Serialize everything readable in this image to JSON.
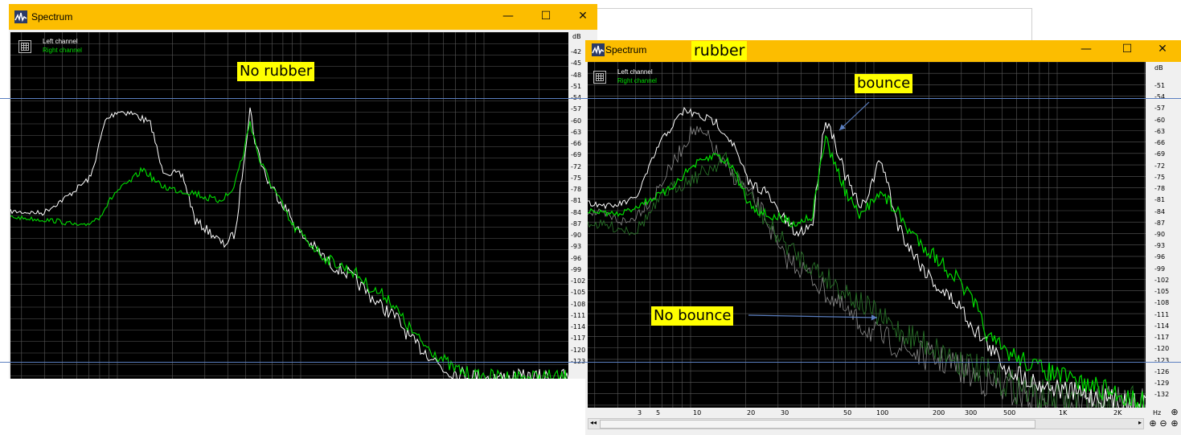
{
  "window_title": "Spectrum",
  "left_window": {
    "title": "Spectrum",
    "legend": {
      "left": "Left channel",
      "right": "Right channel"
    },
    "callout": "No rubber",
    "db_unit": "dB",
    "db_ticks": [
      "-42",
      "-45",
      "-48",
      "-51",
      "-54",
      "-57",
      "-60",
      "-63",
      "-66",
      "-69",
      "-72",
      "-75",
      "-78",
      "-81",
      "-84",
      "-87",
      "-90",
      "-93",
      "-96",
      "-99",
      "-102",
      "-105",
      "-108",
      "-111",
      "-114",
      "-117",
      "-120",
      "-123"
    ]
  },
  "right_window": {
    "title": "Spectrum",
    "legend": {
      "left": "Left channel",
      "right": "Right channel"
    },
    "callout_title": "rubber",
    "callout_bounce": "bounce",
    "callout_nobounce": "No bounce",
    "db_unit": "dB",
    "hz_unit": "Hz",
    "db_ticks": [
      "-51",
      "-54",
      "-57",
      "-60",
      "-63",
      "-66",
      "-69",
      "-72",
      "-75",
      "-78",
      "-81",
      "-84",
      "-87",
      "-90",
      "-93",
      "-96",
      "-99",
      "-102",
      "-105",
      "-108",
      "-111",
      "-114",
      "-117",
      "-120",
      "-123",
      "-126",
      "-129",
      "-132"
    ],
    "freq_ticks": [
      "3",
      "5",
      "10",
      "20",
      "30",
      "50",
      "100",
      "200",
      "300",
      "500",
      "1K",
      "2K"
    ]
  },
  "controls": {
    "minimize": "—",
    "maximize": "☐",
    "close": "✕"
  },
  "colors": {
    "titlebar": "#fcbd00",
    "plot_bg": "#000000",
    "grid": "#5a5a5a",
    "left_channel": "#ffffff",
    "right_channel": "#00dd00",
    "callout": "#ffff00",
    "guide_line": "#5b7fc0"
  }
}
